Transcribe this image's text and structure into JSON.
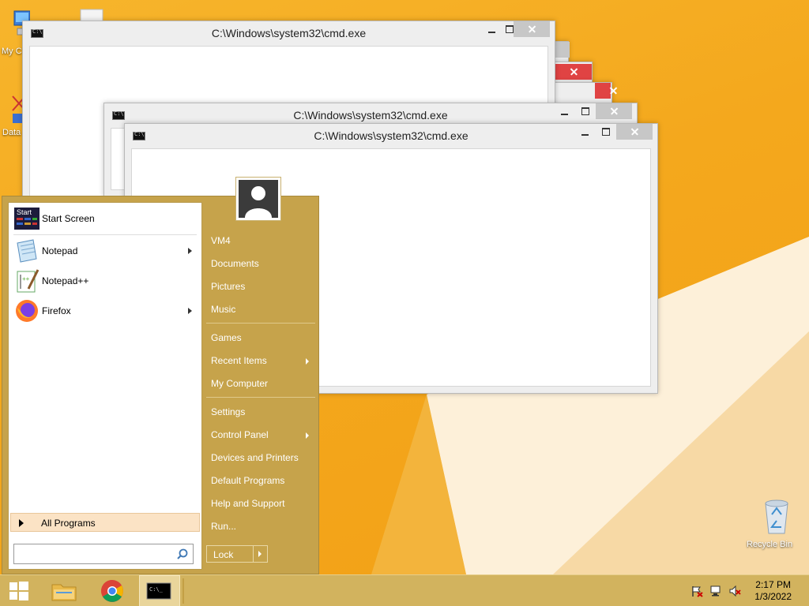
{
  "desktop": {
    "icons": [
      {
        "label": "My C",
        "name": "my-computer"
      },
      {
        "label": "",
        "name": "file"
      },
      {
        "label": "Data",
        "name": "data"
      },
      {
        "label": "Recycle Bin",
        "name": "recycle-bin"
      }
    ]
  },
  "windows": [
    {
      "title": "C:\\Windows\\system32\\cmd.exe"
    },
    {
      "title": "C:\\Windows\\system32\\cmd.exe"
    },
    {
      "title": "C:\\Windows\\system32\\cmd.exe"
    }
  ],
  "start_menu": {
    "left_items": [
      {
        "label": "Start Screen",
        "icon": "start-screen-icon",
        "submenu": false
      },
      {
        "label": "Notepad",
        "icon": "notepad-icon",
        "submenu": true
      },
      {
        "label": "Notepad++",
        "icon": "notepadpp-icon",
        "submenu": false
      },
      {
        "label": "Firefox",
        "icon": "firefox-icon",
        "submenu": true
      }
    ],
    "start_icon_text": "Start",
    "all_programs": "All Programs",
    "search_placeholder": "",
    "right_items": [
      {
        "label": "VM4"
      },
      {
        "label": "Documents"
      },
      {
        "label": "Pictures"
      },
      {
        "label": "Music"
      },
      {
        "label": "Games"
      },
      {
        "label": "Recent Items",
        "submenu": true
      },
      {
        "label": "My Computer"
      },
      {
        "label": "Settings"
      },
      {
        "label": "Control Panel",
        "submenu": true
      },
      {
        "label": "Devices and Printers"
      },
      {
        "label": "Default Programs"
      },
      {
        "label": "Help and Support"
      },
      {
        "label": "Run..."
      }
    ],
    "lock_label": "Lock"
  },
  "taskbar": {
    "pinned": [
      "start-button",
      "file-explorer",
      "chrome",
      "cmd"
    ],
    "clock_time": "2:17 PM",
    "clock_date": "1/3/2022"
  },
  "colors": {
    "desktop": "#f4a81d",
    "start_menu": "#c6a34b",
    "taskbar": "#d2b35e",
    "close_red": "#e04343"
  }
}
